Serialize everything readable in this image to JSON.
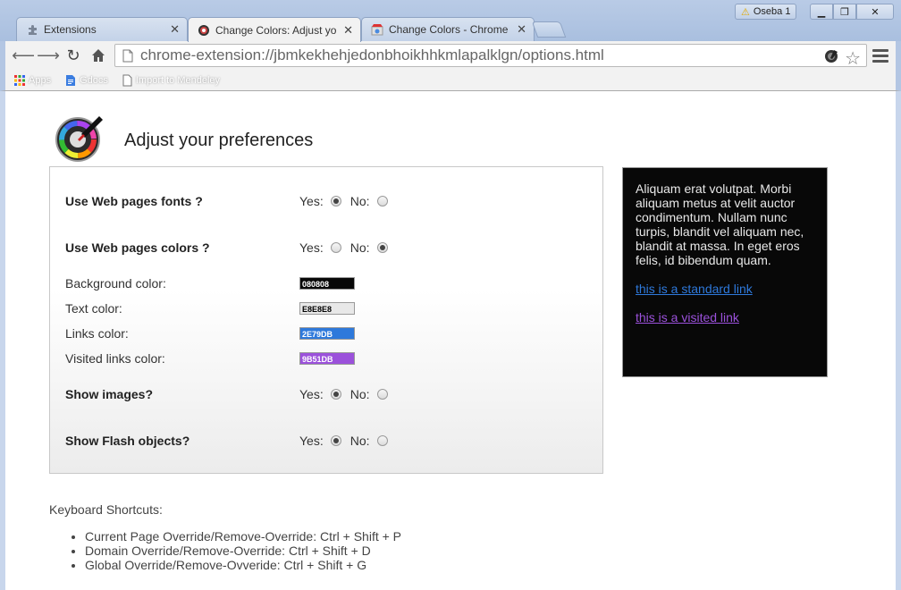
{
  "browser": {
    "tabs": [
      {
        "label": "Extensions"
      },
      {
        "label": "Change Colors: Adjust yo"
      },
      {
        "label": "Change Colors - Chrome"
      }
    ],
    "user": "Oseba 1",
    "address": "chrome-extension://jbmkekhehjedonbhoikhhkmlapalklgn/options.html",
    "bookmarks": [
      {
        "label": "Apps"
      },
      {
        "label": "Gdocs"
      },
      {
        "label": "Import to Mendeley"
      }
    ]
  },
  "page": {
    "title": "Adjust your preferences",
    "yes_label": "Yes:",
    "no_label": "No:",
    "options": {
      "fonts": {
        "label": "Use Web pages fonts ?",
        "value": "yes"
      },
      "colors": {
        "label": "Use Web pages colors ?",
        "value": "no"
      },
      "images": {
        "label": "Show images?",
        "value": "yes"
      },
      "flash": {
        "label": "Show Flash objects?",
        "value": "yes"
      }
    },
    "colors": {
      "background": {
        "label": "Background color:",
        "value": "080808",
        "hex": "#080808",
        "text_hex": "#ffffff"
      },
      "text": {
        "label": "Text color:",
        "value": "E8E8E8",
        "hex": "#e8e8e8",
        "text_hex": "#000000"
      },
      "links": {
        "label": "Links color:",
        "value": "2E79DB",
        "hex": "#2e79db",
        "text_hex": "#ffffff"
      },
      "visited": {
        "label": "Visited links color:",
        "value": "9B51DB",
        "hex": "#9b51db",
        "text_hex": "#ffffff"
      }
    },
    "preview": {
      "text": "Aliquam erat volutpat. Morbi aliquam metus at velit auctor condimentum. Nullam nunc turpis, blandit vel aliquam nec, blandit at massa. In eget eros felis, id bibendum quam.",
      "standard_link": "this is a standard link",
      "visited_link": "this is a visited link"
    },
    "shortcuts": {
      "title": "Keyboard Shortcuts:",
      "items": [
        "Current Page Override/Remove-Override: Ctrl + Shift + P",
        "Domain Override/Remove-Override: Ctrl + Shift + D",
        "Global Override/Remove-Ovveride: Ctrl + Shift + G"
      ]
    }
  }
}
